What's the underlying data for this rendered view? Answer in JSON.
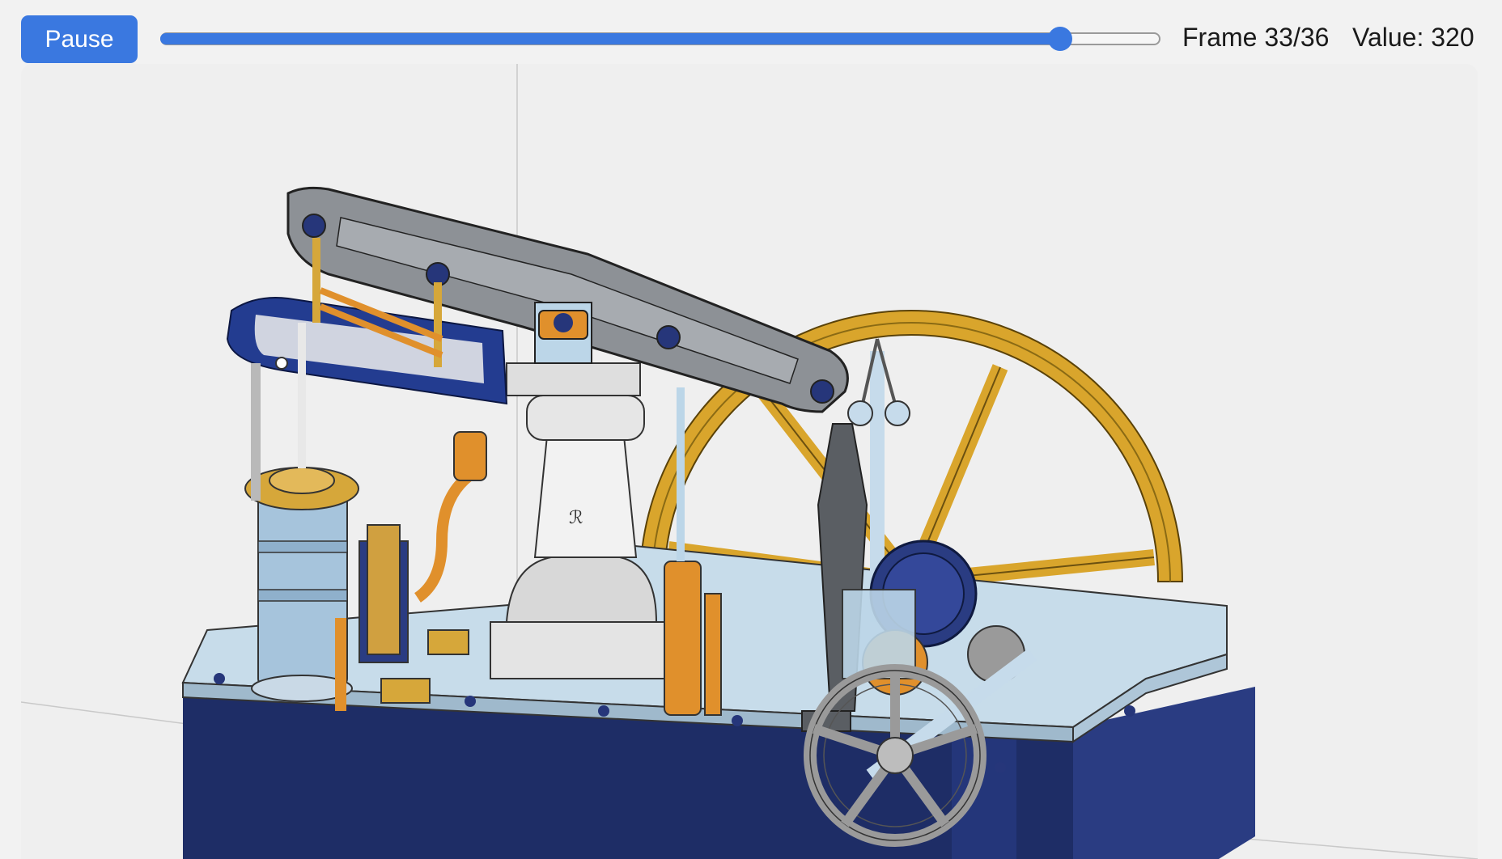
{
  "controls": {
    "pause_label": "Pause",
    "frame_text": "Frame 33/36",
    "value_text": "Value: 320",
    "slider_fraction": 0.9
  },
  "colors": {
    "accent": "#3a78e0",
    "base_navy": "#1e2d66",
    "flywheel_gold": "#d9a52c",
    "brass_orange": "#e0902c",
    "steel_gray": "#8d9196",
    "light_blue_steel": "#bcd6e8"
  }
}
